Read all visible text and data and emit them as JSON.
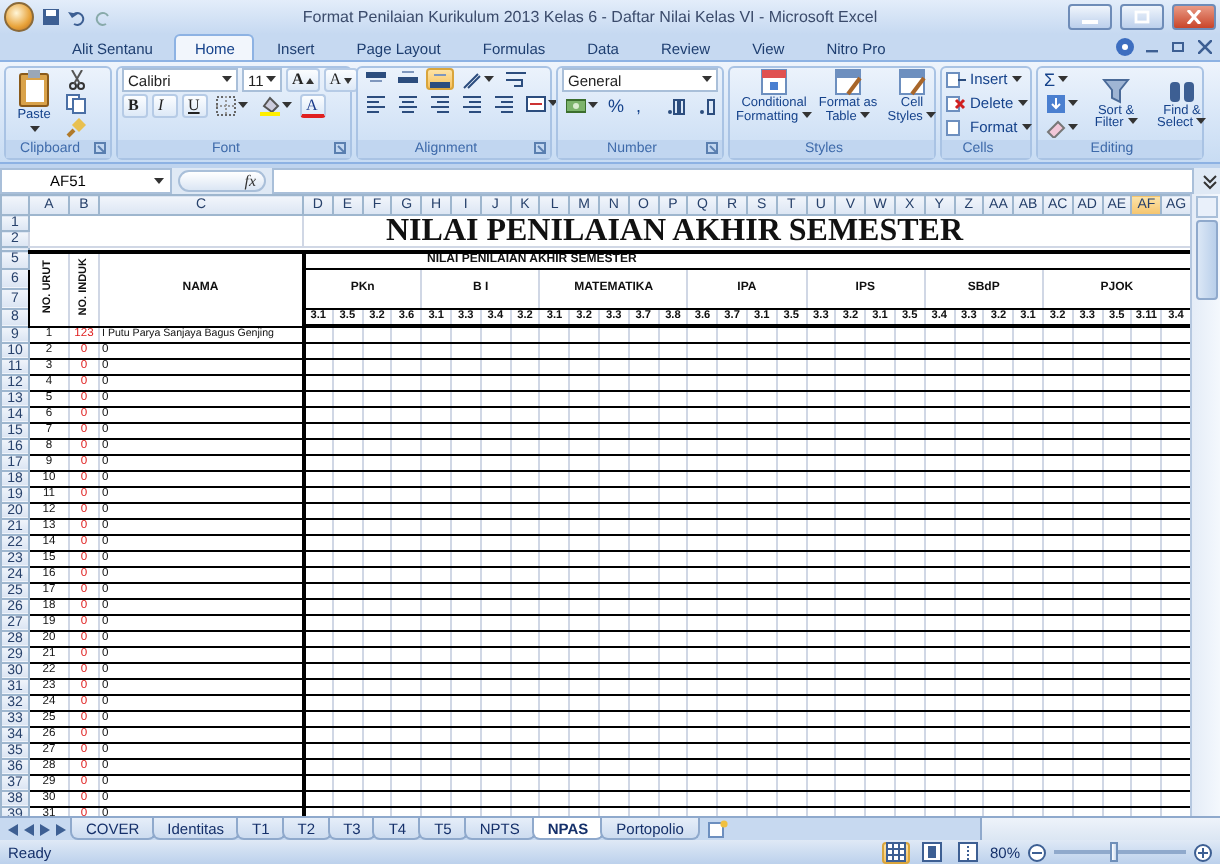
{
  "window": {
    "title": "Format Penilaian Kurikulum 2013 Kelas 6 - Daftar Nilai Kelas VI - Microsoft Excel"
  },
  "ribbon_tabs": [
    {
      "label": "Alit Sentanu",
      "selected": false
    },
    {
      "label": "Home",
      "selected": true
    },
    {
      "label": "Insert",
      "selected": false
    },
    {
      "label": "Page Layout",
      "selected": false
    },
    {
      "label": "Formulas",
      "selected": false
    },
    {
      "label": "Data",
      "selected": false
    },
    {
      "label": "Review",
      "selected": false
    },
    {
      "label": "View",
      "selected": false
    },
    {
      "label": "Nitro Pro",
      "selected": false
    }
  ],
  "ribbon_groups": [
    {
      "kind": "clipboard",
      "title": "Clipboard",
      "label": "Paste"
    },
    {
      "kind": "font",
      "title": "Font",
      "font": "Calibri",
      "size": "11",
      "grow_label": "A",
      "shrink_label": "A",
      "style_buttons": [
        "B",
        "I",
        "U"
      ],
      "font_color_label": "A"
    },
    {
      "kind": "alignment",
      "title": "Alignment",
      "vertical_align": [
        {
          "kind": "top",
          "selected": false
        },
        {
          "kind": "middle",
          "selected": false
        },
        {
          "kind": "bottom",
          "selected": true
        }
      ]
    },
    {
      "kind": "number",
      "title": "Number",
      "format": "General",
      "buttons": [
        "%",
        ","
      ]
    },
    {
      "kind": "styles",
      "title": "Styles",
      "buttons": [
        "Conditional Formatting",
        "Format as Table",
        "Cell Styles"
      ]
    },
    {
      "kind": "cells",
      "title": "Cells",
      "buttons": [
        "Insert",
        "Delete",
        "Format"
      ]
    },
    {
      "kind": "editing",
      "title": "Editing",
      "sigma": "Σ",
      "buttons": [
        "Sort & Filter",
        "Find & Select"
      ]
    }
  ],
  "formula_bar": {
    "name_box": "AF51",
    "function_label": "fx"
  },
  "sheet": {
    "columns": [
      {
        "label": "A",
        "selected": false
      },
      {
        "label": "B",
        "selected": false
      },
      {
        "label": "C",
        "selected": false
      },
      {
        "label": "D",
        "selected": false
      },
      {
        "label": "E",
        "selected": false
      },
      {
        "label": "F",
        "selected": false
      },
      {
        "label": "G",
        "selected": false
      },
      {
        "label": "H",
        "selected": false
      },
      {
        "label": "I",
        "selected": false
      },
      {
        "label": "J",
        "selected": false
      },
      {
        "label": "K",
        "selected": false
      },
      {
        "label": "L",
        "selected": false
      },
      {
        "label": "M",
        "selected": false
      },
      {
        "label": "N",
        "selected": false
      },
      {
        "label": "O",
        "selected": false
      },
      {
        "label": "P",
        "selected": false
      },
      {
        "label": "Q",
        "selected": false
      },
      {
        "label": "R",
        "selected": false
      },
      {
        "label": "S",
        "selected": false
      },
      {
        "label": "T",
        "selected": false
      },
      {
        "label": "U",
        "selected": false
      },
      {
        "label": "V",
        "selected": false
      },
      {
        "label": "W",
        "selected": false
      },
      {
        "label": "X",
        "selected": false
      },
      {
        "label": "Y",
        "selected": false
      },
      {
        "label": "Z",
        "selected": false
      },
      {
        "label": "AA",
        "selected": false
      },
      {
        "label": "AB",
        "selected": false
      },
      {
        "label": "AC",
        "selected": false
      },
      {
        "label": "AD",
        "selected": false
      },
      {
        "label": "AE",
        "selected": false
      },
      {
        "label": "AF",
        "selected": true
      },
      {
        "label": "AG",
        "selected": false
      }
    ],
    "header_row_numbers": [
      "1",
      "2",
      "5",
      "6",
      "7",
      "8"
    ],
    "title": "NILAI PENILAIAN AKHIR SEMESTER",
    "headers": [
      {
        "label": "NO. URUT",
        "kind": "vertical"
      },
      {
        "label": "NO. INDUK",
        "kind": "vertical"
      },
      {
        "label": "NAMA",
        "kind": "horizontal"
      }
    ],
    "section_title": "NILAI PENILAIAN AKHIR SEMESTER",
    "subjects": [
      {
        "name": "PKn",
        "codes": [
          "3.1",
          "3.5",
          "3.2",
          "3.6"
        ]
      },
      {
        "name": "B I",
        "codes": [
          "3.1",
          "3.3",
          "3.4",
          "3.2"
        ]
      },
      {
        "name": "MATEMATIKA",
        "codes": [
          "3.1",
          "3.2",
          "3.3",
          "3.7",
          "3.8"
        ]
      },
      {
        "name": "IPA",
        "codes": [
          "3.6",
          "3.7",
          "3.1",
          "3.5"
        ]
      },
      {
        "name": "IPS",
        "codes": [
          "3.3",
          "3.2",
          "3.1",
          "3.5"
        ]
      },
      {
        "name": "SBdP",
        "codes": [
          "3.4",
          "3.3",
          "3.2",
          "3.1"
        ]
      },
      {
        "name": "PJOK",
        "codes": [
          "3.2",
          "3.3",
          "3.5",
          "3.11",
          "3.4"
        ]
      }
    ],
    "rows": [
      {
        "row": "9",
        "urut": "1",
        "induk": "123",
        "nama": "I Putu Parya Sanjaya Bagus Genjing"
      },
      {
        "row": "10",
        "urut": "2",
        "induk": "0",
        "nama": "0"
      },
      {
        "row": "11",
        "urut": "3",
        "induk": "0",
        "nama": "0"
      },
      {
        "row": "12",
        "urut": "4",
        "induk": "0",
        "nama": "0"
      },
      {
        "row": "13",
        "urut": "5",
        "induk": "0",
        "nama": "0"
      },
      {
        "row": "14",
        "urut": "6",
        "induk": "0",
        "nama": "0"
      },
      {
        "row": "15",
        "urut": "7",
        "induk": "0",
        "nama": "0"
      },
      {
        "row": "16",
        "urut": "8",
        "induk": "0",
        "nama": "0"
      },
      {
        "row": "17",
        "urut": "9",
        "induk": "0",
        "nama": "0"
      },
      {
        "row": "18",
        "urut": "10",
        "induk": "0",
        "nama": "0"
      },
      {
        "row": "19",
        "urut": "11",
        "induk": "0",
        "nama": "0"
      },
      {
        "row": "20",
        "urut": "12",
        "induk": "0",
        "nama": "0"
      },
      {
        "row": "21",
        "urut": "13",
        "induk": "0",
        "nama": "0"
      },
      {
        "row": "22",
        "urut": "14",
        "induk": "0",
        "nama": "0"
      },
      {
        "row": "23",
        "urut": "15",
        "induk": "0",
        "nama": "0"
      },
      {
        "row": "24",
        "urut": "16",
        "induk": "0",
        "nama": "0"
      },
      {
        "row": "25",
        "urut": "17",
        "induk": "0",
        "nama": "0"
      },
      {
        "row": "26",
        "urut": "18",
        "induk": "0",
        "nama": "0"
      },
      {
        "row": "27",
        "urut": "19",
        "induk": "0",
        "nama": "0"
      },
      {
        "row": "28",
        "urut": "20",
        "induk": "0",
        "nama": "0"
      },
      {
        "row": "29",
        "urut": "21",
        "induk": "0",
        "nama": "0"
      },
      {
        "row": "30",
        "urut": "22",
        "induk": "0",
        "nama": "0"
      },
      {
        "row": "31",
        "urut": "23",
        "induk": "0",
        "nama": "0"
      },
      {
        "row": "32",
        "urut": "24",
        "induk": "0",
        "nama": "0"
      },
      {
        "row": "33",
        "urut": "25",
        "induk": "0",
        "nama": "0"
      },
      {
        "row": "34",
        "urut": "26",
        "induk": "0",
        "nama": "0"
      },
      {
        "row": "35",
        "urut": "27",
        "induk": "0",
        "nama": "0"
      },
      {
        "row": "36",
        "urut": "28",
        "induk": "0",
        "nama": "0"
      },
      {
        "row": "37",
        "urut": "29",
        "induk": "0",
        "nama": "0"
      },
      {
        "row": "38",
        "urut": "30",
        "induk": "0",
        "nama": "0"
      },
      {
        "row": "39",
        "urut": "31",
        "induk": "0",
        "nama": "0"
      }
    ]
  },
  "sheet_tabs": [
    {
      "label": "COVER",
      "selected": false
    },
    {
      "label": "Identitas",
      "selected": false
    },
    {
      "label": "T1",
      "selected": false
    },
    {
      "label": "T2",
      "selected": false
    },
    {
      "label": "T3",
      "selected": false
    },
    {
      "label": "T4",
      "selected": false
    },
    {
      "label": "T5",
      "selected": false
    },
    {
      "label": "NPTS",
      "selected": false
    },
    {
      "label": "NPAS",
      "selected": true
    },
    {
      "label": "Portopolio",
      "selected": false
    }
  ],
  "status_bar": {
    "status": "Ready",
    "views": [
      {
        "kind": "normal",
        "selected": true
      },
      {
        "kind": "layout",
        "selected": false
      },
      {
        "kind": "break",
        "selected": false
      }
    ],
    "zoom": "80%",
    "zoom_slider": {
      "level": 0.45
    }
  }
}
